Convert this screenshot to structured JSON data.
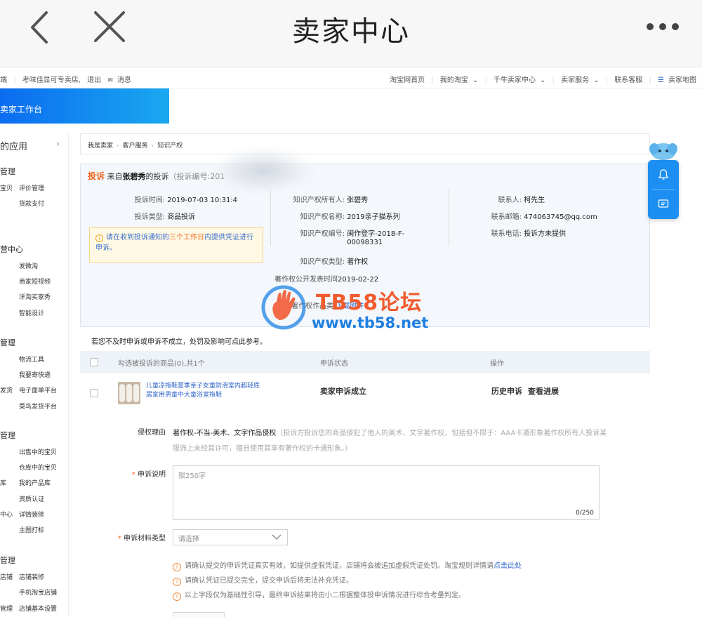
{
  "titlebar": {
    "title": "卖家中心"
  },
  "topbar": {
    "left_frag": "端",
    "shop": "考味佳显可专卖店,",
    "logout": "退出",
    "messages": "消息",
    "links": [
      "淘宝网首页",
      "我的淘宝",
      "千牛卖家中心",
      "卖家服务",
      "联系客服",
      "卖家地图"
    ]
  },
  "banner": {
    "label": "卖家工作台"
  },
  "sidebar": {
    "apps_title": "的应用",
    "groups": [
      {
        "head": "管理",
        "items": [
          {
            "side": "宝贝",
            "text": "评价管理"
          },
          {
            "side": "",
            "text": "货款支付"
          }
        ]
      },
      {
        "head": "营中心",
        "items": [
          {
            "side": "",
            "text": "发微淘"
          },
          {
            "side": "",
            "text": "商家短视频"
          },
          {
            "side": "",
            "text": "洋淘买家秀"
          },
          {
            "side": "",
            "text": "智能设计"
          }
        ]
      },
      {
        "head": "管理",
        "items": [
          {
            "side": "",
            "text": "物流工具"
          },
          {
            "side": "",
            "text": "我要寄快递"
          },
          {
            "side": "发货",
            "text": "电子面单平台"
          },
          {
            "side": "",
            "text": "菜鸟发货平台"
          }
        ]
      },
      {
        "head": "管理",
        "items": [
          {
            "side": "",
            "text": "出售中的宝贝"
          },
          {
            "side": "",
            "text": "仓库中的宝贝"
          },
          {
            "side": "库",
            "text": "我的产品库"
          },
          {
            "side": "",
            "text": "资质认证"
          },
          {
            "side": "中心",
            "text": "详情装修"
          },
          {
            "side": "",
            "text": "主图打标"
          }
        ]
      },
      {
        "head": "管理",
        "items": [
          {
            "side": "店铺",
            "text": "店铺装修"
          },
          {
            "side": "",
            "text": "手机淘宝店铺"
          },
          {
            "side": "管理",
            "text": "店铺基本设置"
          }
        ]
      }
    ]
  },
  "breadcrumb": [
    "我是卖家",
    "客户服务",
    "知识产权"
  ],
  "complaint": {
    "tag": "投诉",
    "from_prefix": "来自",
    "complainant": "张碧秀",
    "from_suffix": "的投诉",
    "number_prefix": "（投诉编号:201",
    "fields_left": [
      {
        "label": "投诉时间:",
        "value": "2019-07-03 10:31:4"
      },
      {
        "label": "投诉类型:",
        "value": "商品投诉"
      }
    ],
    "notice": {
      "pre": "请在收到投诉通知的",
      "highlight": "三个工作日",
      "post": "内提供凭证进行申诉。"
    },
    "fields_mid": [
      {
        "label": "知识产权所有人:",
        "value": "张碧秀"
      },
      {
        "label": "知识产权名称:",
        "value": "2019亲子猫系列"
      },
      {
        "label": "知识产权编号:",
        "value": "闽作登字-2018-F-"
      },
      {
        "label": "",
        "value": "00098331"
      },
      {
        "label": "知识产权类型:",
        "value": "著作权"
      }
    ],
    "published_label": "著作权公开发表时间",
    "published_value": "2019-02-22",
    "works_label": "著作权作品类:",
    "works_link": "下载附件",
    "fields_right": [
      {
        "label": "联系人:",
        "value": "柯先生"
      },
      {
        "label": "联系邮箱:",
        "value": "474063745@qq.com"
      },
      {
        "label": "联系电话:",
        "value": "投诉方未提供"
      }
    ]
  },
  "hint": "若您不及时申诉或申诉不成立，处罚及影响可点此参考。",
  "table": {
    "headers": [
      "勾选被投诉的商品(0),共1个",
      "申诉状态",
      "操作"
    ],
    "row": {
      "name": "儿童凉拖鞋夏季亲子女童防滑室内超轻底居家用男童中大童浴室拖鞋",
      "status": "卖家申诉成立",
      "op1": "历史申诉",
      "op2": "查看进展"
    }
  },
  "form": {
    "reason_label": "侵权理由",
    "reason_value": "著作权-不当-美术、文字作品侵权",
    "reason_desc": "（投诉方投诉您的商品侵犯了他人的美术、文字著作权，包括但不限于：AAA卡通形象著作权所有人投诉某服饰上未经其许可，擅自使用其享有著作权的卡通形象。）",
    "explain_label": "申诉说明",
    "explain_placeholder": "限250字",
    "explain_count": "0/250",
    "material_label": "申诉材料类型",
    "material_placeholder": "请选择",
    "tips": [
      {
        "text": "请确认提交的申诉凭证真实有效，如提供虚假凭证，店铺将会被追加虚假凭证处罚。淘宝规则详情请",
        "link": "点击此处"
      },
      {
        "text": "请确认凭证已提交完全，提交申诉后将无法补充凭证。",
        "link": ""
      },
      {
        "text": "以上字段仅为基础性引导，最终申诉结果将由小二根据整体投申诉情况进行综合考量判定。",
        "link": ""
      }
    ]
  },
  "watermark": {
    "title": "TB58论坛",
    "url": "www.tb58.net"
  },
  "colors": {
    "brand_blue": "#1d8ff2",
    "accent_orange": "#f2651d",
    "link_blue": "#2c63c6"
  }
}
